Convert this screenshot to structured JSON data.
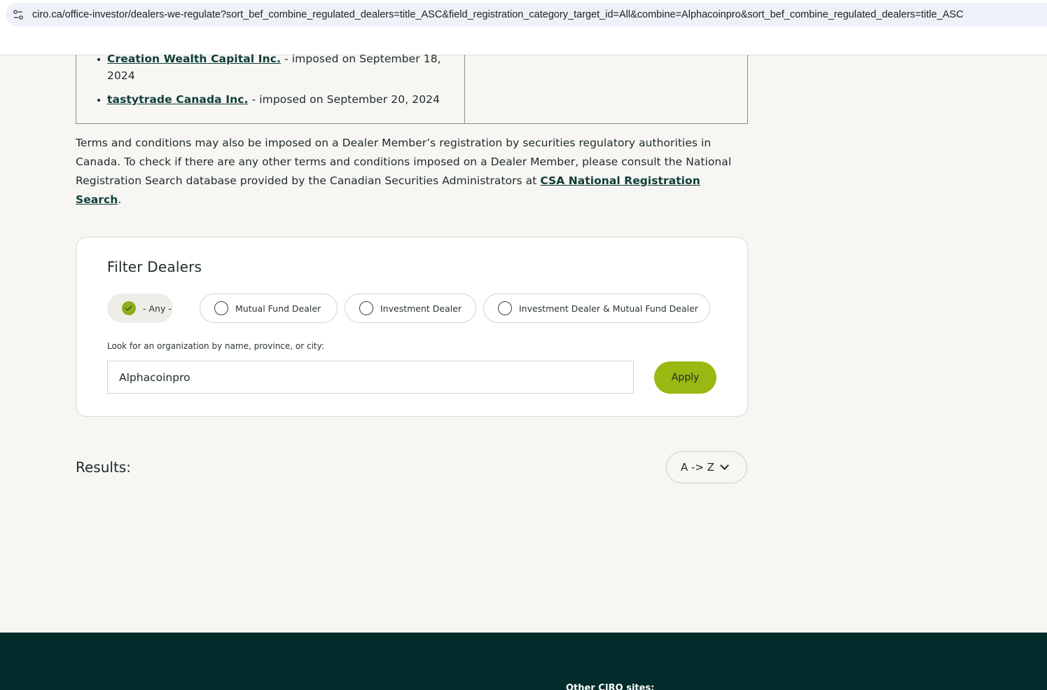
{
  "browser": {
    "url": "ciro.ca/office-investor/dealers-we-regulate?sort_bef_combine_regulated_dealers=title_ASC&field_registration_category_target_id=All&combine=Alphacoinpro&sort_bef_combine_regulated_dealers=title_ASC"
  },
  "terms_list": [
    {
      "dealer": "Creation Wealth Capital Inc.",
      "text": " - imposed on September 18, 2024"
    },
    {
      "dealer": "tastytrade Canada Inc.",
      "text": " - imposed on September 20, 2024"
    }
  ],
  "notice": {
    "text": "Terms and conditions may also be imposed on a Dealer Member’s registration by securities regulatory authorities in Canada. To check if there are any other terms and conditions imposed on a Dealer Member, please consult the National Registration Search database provided by the Canadian Securities Administrators at ",
    "link": "CSA National Registration Search",
    "end": "."
  },
  "filter": {
    "title": "Filter Dealers",
    "options": [
      {
        "label": "- Any -",
        "selected": true
      },
      {
        "label": "Mutual Fund Dealer",
        "selected": false
      },
      {
        "label": "Investment Dealer",
        "selected": false
      },
      {
        "label": "Investment Dealer & Mutual Fund Dealer",
        "selected": false
      }
    ],
    "search_label": "Look for an organization by name, province, or city:",
    "search_value": "Alphacoinpro",
    "apply_label": "Apply"
  },
  "results": {
    "label": "Results:",
    "sort_label": "A -> Z"
  },
  "footer": {
    "heading": "Other CIRO sites:"
  },
  "colors": {
    "accent": "#9ab812",
    "footer_bg": "#032d2c",
    "link": "#0f3d38"
  }
}
